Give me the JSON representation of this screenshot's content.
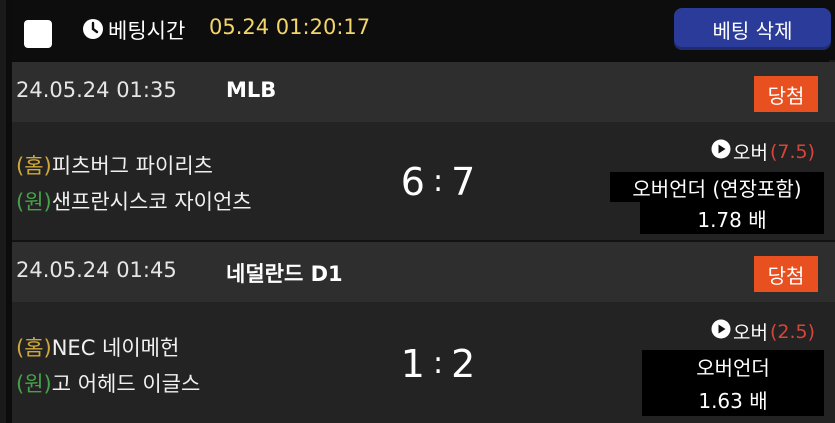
{
  "header": {
    "bet_time_label": "베팅시간",
    "bet_time_value": "05.24 01:20:17",
    "delete_button": "베팅 삭제"
  },
  "games": [
    {
      "date": "24.05.24 01:35",
      "league": "MLB",
      "result": "당첨",
      "home_tag": "(홈)",
      "home_team": "피츠버그 파이리츠",
      "away_tag": "(원)",
      "away_team": "샌프란시스코 자이언츠",
      "score_home": "6",
      "score_away": "7",
      "pick_label": "오버",
      "pick_value": "(7.5)",
      "market": "오버언더 (연장포함)",
      "odds": "1.78 배"
    },
    {
      "date": "24.05.24 01:45",
      "league": "네덜란드 D1",
      "result": "당첨",
      "home_tag": "(홈)",
      "home_team": "NEC 네이메헌",
      "away_tag": "(원)",
      "away_team": "고 어헤드 이글스",
      "score_home": "1",
      "score_away": "2",
      "pick_label": "오버",
      "pick_value": "(2.5)",
      "market": "오버언더",
      "odds": "1.63 배"
    }
  ],
  "colors": {
    "accent_yellow": "#f3d56a",
    "delete_button_bg": "#2b3b99",
    "badge_orange": "#e8501f",
    "home_tag": "#d0a83a",
    "away_tag": "#46a24a",
    "pick_value_red": "#d6453a"
  },
  "icons": {
    "clock": "clock-icon",
    "play": "play-circle-icon"
  }
}
